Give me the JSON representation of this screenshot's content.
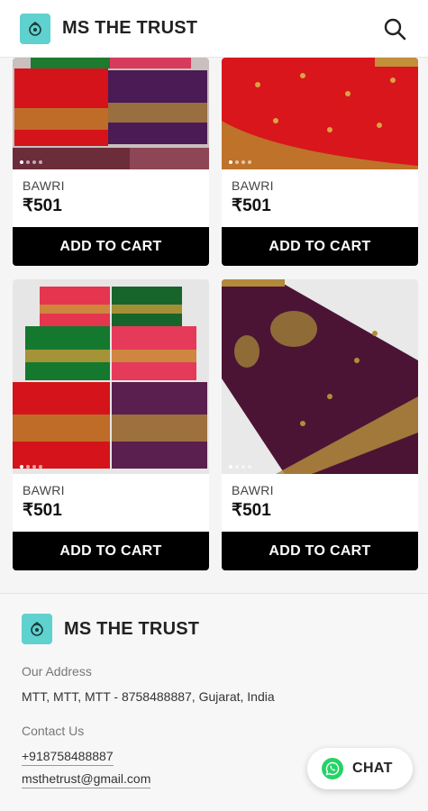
{
  "header": {
    "brand": "MS THE TRUST",
    "logo_icon": "trust-logo-icon",
    "search_icon": "search-icon"
  },
  "products": [
    {
      "brand": "BAWRI",
      "price": "₹501",
      "cta": "ADD TO CART"
    },
    {
      "brand": "BAWRI",
      "price": "₹501",
      "cta": "ADD TO CART"
    },
    {
      "brand": "BAWRI",
      "price": "₹501",
      "cta": "ADD TO CART"
    },
    {
      "brand": "BAWRI",
      "price": "₹501",
      "cta": "ADD TO CART"
    }
  ],
  "footer": {
    "brand": "MS THE TRUST",
    "address_label": "Our Address",
    "address": "MTT, MTT, MTT - 8758488887, Gujarat, India",
    "contact_label": "Contact Us",
    "phone": "+918758488887",
    "email": "msthetrust@gmail.com"
  },
  "chat": {
    "label": "CHAT",
    "icon": "whatsapp-icon"
  },
  "colors": {
    "accent": "#5fd1cf",
    "button": "#000000",
    "whatsapp": "#25d366"
  }
}
